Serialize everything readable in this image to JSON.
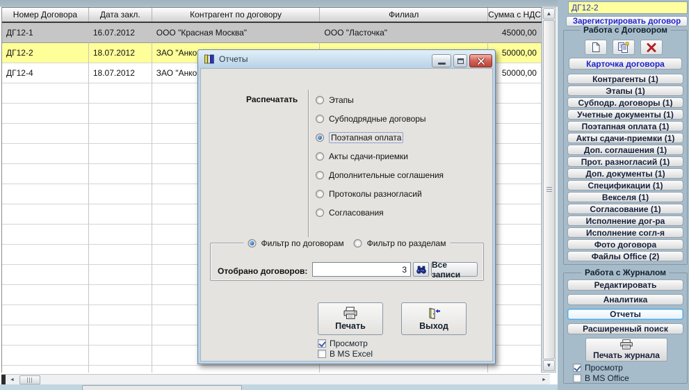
{
  "colors": {
    "sidebar_bg": "#a6bcca",
    "row_current_bg": "#c6c6c6",
    "row_marked_bg": "#ffff99",
    "accent_blue_text": "#2222cc",
    "active_button_border": "#5aa8dc",
    "dialog_bg": "#e4e3e0",
    "current_contract_bg": "#ffffa0"
  },
  "icons": {
    "scroll_up": "▲",
    "scroll_down": "▼",
    "scroll_left": "◄",
    "scroll_right": "►"
  },
  "table": {
    "columns": [
      {
        "label": "Номер Договора"
      },
      {
        "label": "Дата закл."
      },
      {
        "label": "Контрагент по договору"
      },
      {
        "label": "Филиал"
      },
      {
        "label": "Сумма с НДС"
      }
    ],
    "rows": [
      {
        "number": "ДГ12-1",
        "date": "16.07.2012",
        "contractor": "ООО \"Красная Москва\"",
        "branch": "ООО \"Ласточка\"",
        "sum": "45000,00",
        "state": "current"
      },
      {
        "number": "ДГ12-2",
        "date": "18.07.2012",
        "contractor": "ЗАО \"Анко",
        "branch": "",
        "sum": "50000,00",
        "state": "marked"
      },
      {
        "number": "ДГ12-4",
        "date": "18.07.2012",
        "contractor": "ЗАО \"Анко",
        "branch": "",
        "sum": "50000,00",
        "state": ""
      }
    ]
  },
  "dialog": {
    "title": "Отчеты",
    "print_section_label": "Распечатать",
    "report_options": [
      {
        "label": "Этапы",
        "selected": false
      },
      {
        "label": "Субподрядные договоры",
        "selected": false
      },
      {
        "label": "Поэтапная оплата",
        "selected": true
      },
      {
        "label": "Акты сдачи-приемки",
        "selected": false
      },
      {
        "label": "Дополнительные соглашения",
        "selected": false
      },
      {
        "label": "Протоколы разногласий",
        "selected": false
      },
      {
        "label": "Согласования",
        "selected": false
      }
    ],
    "filter_options": [
      {
        "label": "Фильтр по договорам",
        "selected": true
      },
      {
        "label": "Фильтр по разделам",
        "selected": false
      }
    ],
    "selected_count_label": "Отобрано договоров:",
    "selected_count_value": "3",
    "all_records_button": "Все записи",
    "print_button": "Печать",
    "exit_button": "Выход",
    "output_checkboxes": [
      {
        "label": "Просмотр",
        "checked": true
      },
      {
        "label": "В MS Excel",
        "checked": false
      }
    ]
  },
  "sidebar": {
    "current_contract": "ДГ12-2",
    "register_button": "Зарегистрировать договор",
    "contract_group": {
      "title": "Работа с Договором",
      "card_button": "Карточка договора",
      "section_buttons": [
        {
          "label": "Контрагенты (1)"
        },
        {
          "label": "Этапы (1)"
        },
        {
          "label": "Субподр. договоры (1)"
        },
        {
          "label": "Учетные документы (1)"
        },
        {
          "label": "Поэтапная оплата (1)"
        },
        {
          "label": "Акты сдачи-приемки (1)"
        },
        {
          "label": "Доп. соглашения (1)"
        },
        {
          "label": "Прот. разногласий (1)"
        },
        {
          "label": "Доп. документы (1)"
        },
        {
          "label": "Спецификации (1)"
        },
        {
          "label": "Векселя (1)"
        },
        {
          "label": "Согласование (1)"
        },
        {
          "label": "Исполнение дог-ра"
        },
        {
          "label": "Исполнение согл-я"
        },
        {
          "label": "Фото договора"
        },
        {
          "label": "Файлы Office (2)"
        }
      ]
    },
    "journal_group": {
      "title": "Работа с Журналом",
      "action_buttons": [
        {
          "label": "Редактировать",
          "active": false
        },
        {
          "label": "Аналитика",
          "active": false
        },
        {
          "label": "Отчеты",
          "active": true
        },
        {
          "label": "Расширенный поиск",
          "active": false
        }
      ],
      "print_journal_button": "Печать журнала",
      "output_checkboxes": [
        {
          "label": "Просмотр",
          "checked": true
        },
        {
          "label": "В MS Office",
          "checked": false
        }
      ]
    }
  }
}
